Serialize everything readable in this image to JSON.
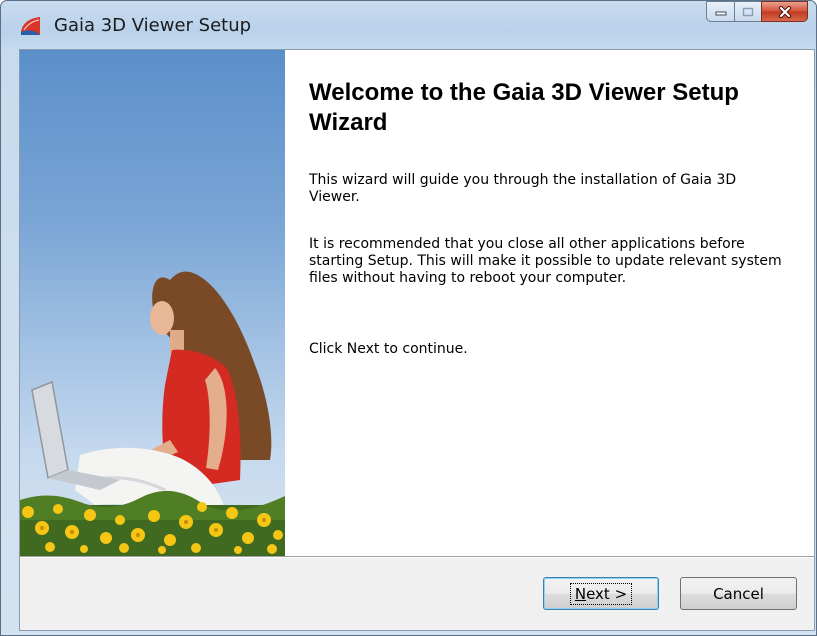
{
  "window": {
    "title": "Gaia 3D Viewer Setup",
    "icon": "installer-icon",
    "caption_buttons": [
      "minimize-icon",
      "maximize-icon",
      "close-icon"
    ]
  },
  "wizard": {
    "heading": "Welcome to the Gaia 3D Viewer Setup Wizard",
    "paragraphs": [
      "This wizard will guide you through the installation of Gaia 3D Viewer.",
      "It is recommended that you close all other applications before starting Setup. This will make it possible to update relevant system files without having to reboot your computer.",
      "Click Next to continue."
    ]
  },
  "buttons": {
    "next_mnemonic": "N",
    "next_rest": "ext >",
    "cancel": "Cancel"
  },
  "colors": {
    "close_button": "#c9472d",
    "focus_border": "#3c7fb1",
    "sky": "#7ba6d6"
  }
}
